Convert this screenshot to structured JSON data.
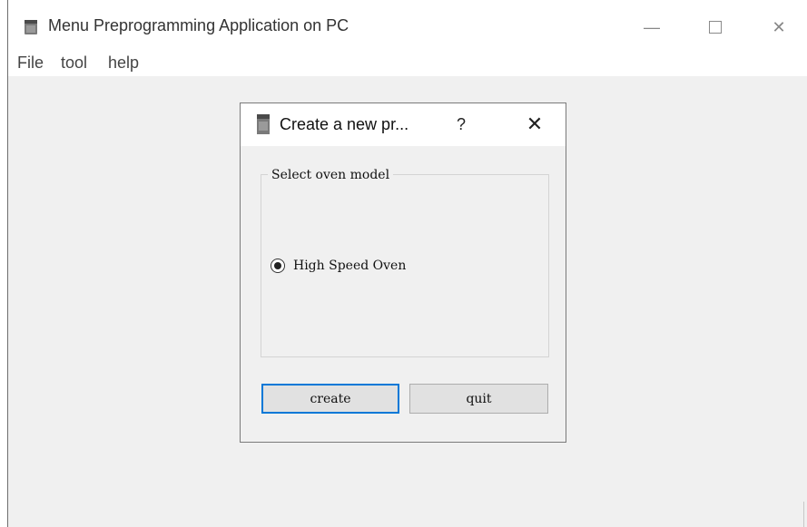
{
  "app": {
    "title": "Menu Preprogramming Application on PC",
    "icon": "oven-icon",
    "controls": {
      "minimize": "—",
      "maximize": "maximize-icon",
      "close": "✕"
    }
  },
  "menubar": {
    "items": [
      {
        "label": "File"
      },
      {
        "label": "tool"
      },
      {
        "label": "help"
      }
    ]
  },
  "dialog": {
    "title": "Create a new pr...",
    "help": "?",
    "close": "✕",
    "group": {
      "legend": "Select oven model",
      "options": [
        {
          "label": "High Speed Oven",
          "selected": true
        }
      ]
    },
    "buttons": {
      "create": "create",
      "quit": "quit"
    }
  },
  "colors": {
    "window_bg": "#f0f0f0",
    "titlebar_bg": "#ffffff",
    "focus_accent": "#0078d7",
    "button_bg": "#e1e1e1"
  }
}
